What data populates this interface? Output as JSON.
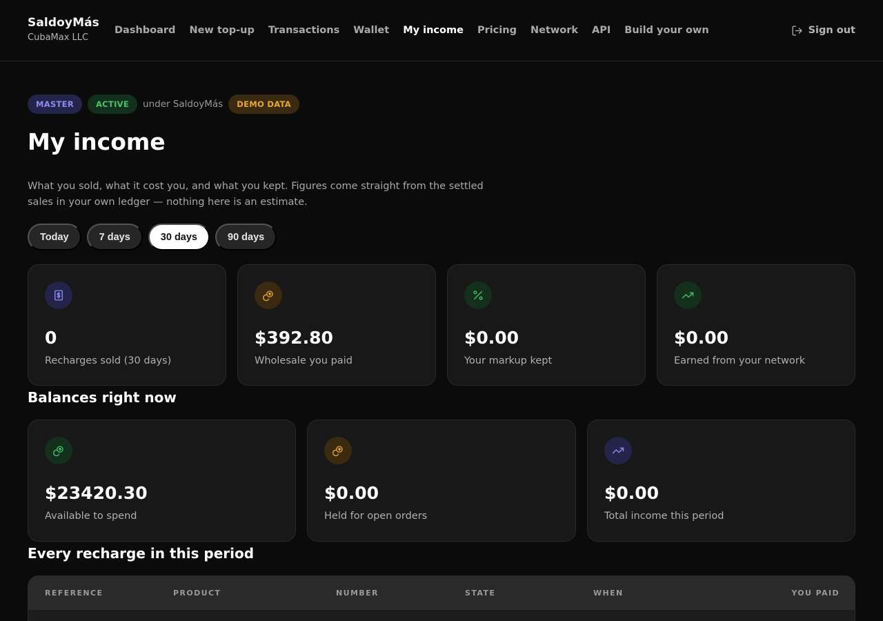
{
  "brand": {
    "name": "SaldoyMás",
    "company": "CubaMax LLC"
  },
  "nav": {
    "items": [
      {
        "label": "Dashboard"
      },
      {
        "label": "New top-up"
      },
      {
        "label": "Transactions"
      },
      {
        "label": "Wallet"
      },
      {
        "label": "My income",
        "active": true
      },
      {
        "label": "Pricing"
      },
      {
        "label": "Network"
      },
      {
        "label": "API"
      },
      {
        "label": "Build your own"
      }
    ],
    "signout": "Sign out",
    "signout_icon": "sign-out-icon"
  },
  "badges": {
    "master": "MASTER",
    "active": "ACTIVE",
    "under": "under SaldoyMás",
    "demo": "DEMO DATA"
  },
  "page": {
    "title": "My income",
    "intro": "What you sold, what it cost you, and what you kept. Figures come straight from the settled sales in your own ledger — nothing here is an estimate."
  },
  "periods": [
    {
      "label": "Today"
    },
    {
      "label": "7 days"
    },
    {
      "label": "30 days",
      "selected": true
    },
    {
      "label": "90 days"
    }
  ],
  "stats": [
    {
      "value": "0",
      "label": "Recharges sold (30 days)",
      "icon": "receipt-dollar-icon",
      "color": "#8c8cf0"
    },
    {
      "value": "$392.80",
      "label": "Wholesale you paid",
      "icon": "coins-icon",
      "color": "#e8a63a"
    },
    {
      "value": "$0.00",
      "label": "Your markup kept",
      "icon": "percent-icon",
      "color": "#4ac26b"
    },
    {
      "value": "$0.00",
      "label": "Earned from your network",
      "icon": "trending-up-icon",
      "color": "#4ac26b"
    }
  ],
  "balances": {
    "title": "Balances right now",
    "items": [
      {
        "value": "$23420.30",
        "label": "Available to spend",
        "icon": "coins-icon",
        "color": "#4ac26b"
      },
      {
        "value": "$0.00",
        "label": "Held for open orders",
        "icon": "coins-icon",
        "color": "#e8a63a"
      },
      {
        "value": "$0.00",
        "label": "Total income this period",
        "icon": "trending-up-icon",
        "color": "#8c8cf0"
      }
    ]
  },
  "recharges": {
    "title": "Every recharge in this period",
    "columns": [
      "REFERENCE",
      "PRODUCT",
      "NUMBER",
      "STATE",
      "WHEN",
      "YOU PAID"
    ]
  }
}
